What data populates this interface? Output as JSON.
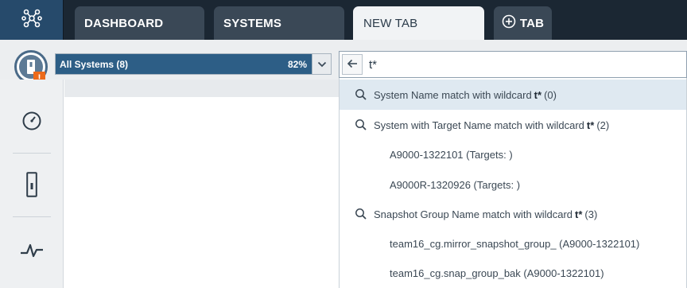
{
  "tabs": [
    {
      "label": "DASHBOARD"
    },
    {
      "label": "SYSTEMS"
    },
    {
      "label": "NEW TAB"
    },
    {
      "label": "TAB"
    }
  ],
  "filter": {
    "label": "All Systems (8)",
    "percent": "82%",
    "warning_badge": "!"
  },
  "search": {
    "value": "t*"
  },
  "results": [
    {
      "type": "group",
      "prefix": "System Name match with wildcard",
      "term": "t*",
      "suffix": "(0)"
    },
    {
      "type": "group",
      "prefix": "System with Target Name match with wildcard",
      "term": "t*",
      "suffix": "(2)"
    },
    {
      "type": "child",
      "text": "A9000-1322101 (Targets: )"
    },
    {
      "type": "child",
      "text": "A9000R-1320926 (Targets: )"
    },
    {
      "type": "group",
      "prefix": "Snapshot Group Name match with wildcard",
      "term": "t*",
      "suffix": "(3)"
    },
    {
      "type": "child",
      "text": "team16_cg.mirror_snapshot_group_ (A9000-1322101)"
    },
    {
      "type": "child",
      "text": "team16_cg.snap_group_bak (A9000-1322101)"
    }
  ],
  "colors": {
    "topbar": "#1b2733",
    "tab_dark": "#3a4856",
    "filter_fill": "#2d5e86",
    "warning": "#ec6a1b",
    "highlight_row": "#dfe9f1"
  },
  "icons": {
    "logo": "network-nodes-icon",
    "add_tab": "plus-circle-icon",
    "back": "arrow-left-icon",
    "search_result": "magnifier-icon",
    "sidebar": [
      "gauge-icon",
      "storage-system-icon",
      "pulse-icon"
    ]
  }
}
